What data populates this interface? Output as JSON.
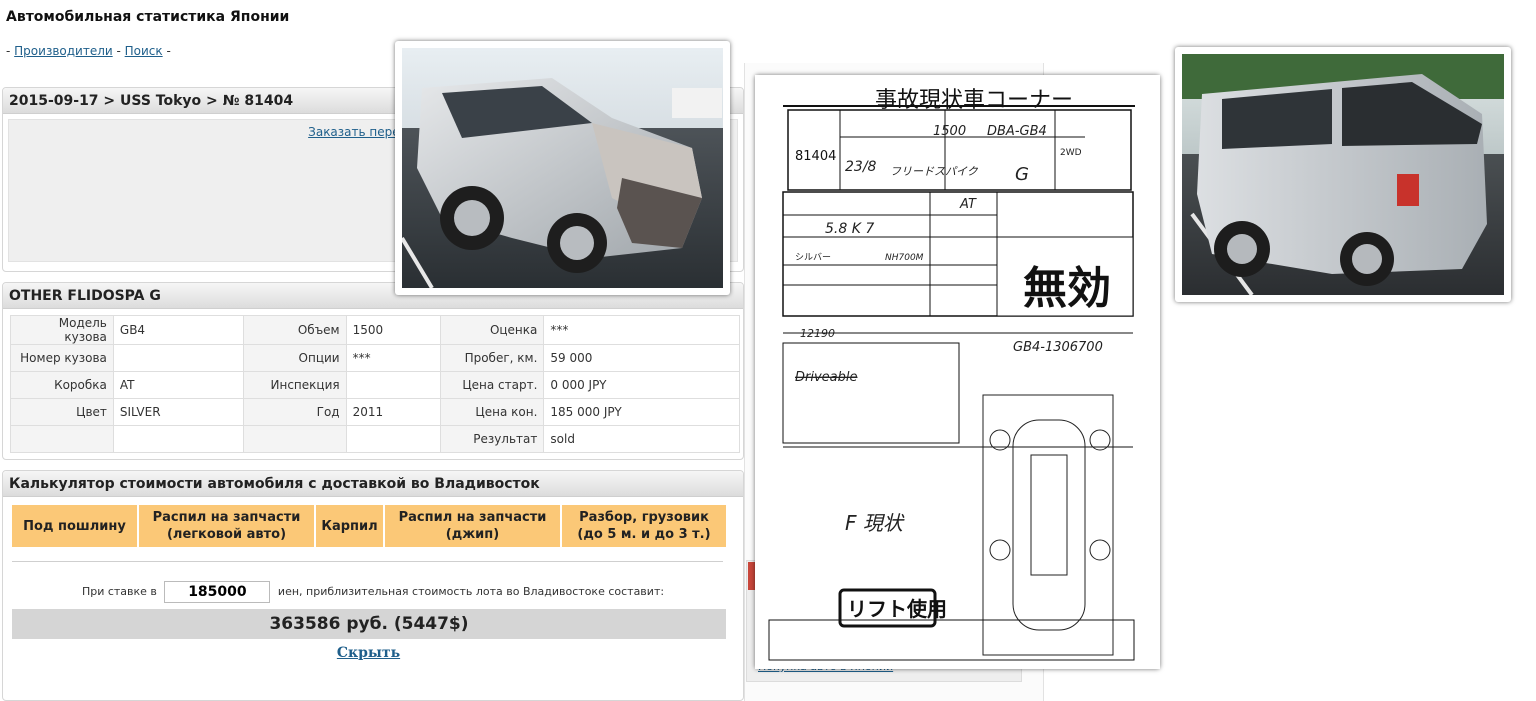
{
  "site": {
    "title": "Автомобильная статистика Японии",
    "nav": {
      "prefix": "- ",
      "link1": "Производители",
      "sep": " - ",
      "link2": "Поиск",
      "suffix": " -"
    }
  },
  "lot": {
    "header": "2015-09-17 > USS Tokyo > № 81404",
    "translate_link": "Заказать перевод аукционного"
  },
  "car": {
    "title": "OTHER FLIDOSPA G",
    "rows": [
      [
        {
          "label": "Модель кузова",
          "value": "GB4"
        },
        {
          "label": "Объем",
          "value": "1500"
        },
        {
          "label": "Оценка",
          "value": "***"
        }
      ],
      [
        {
          "label": "Номер кузова",
          "value": ""
        },
        {
          "label": "Опции",
          "value": "***"
        },
        {
          "label": "Пробег, км.",
          "value": "59 000"
        }
      ],
      [
        {
          "label": "Коробка",
          "value": "AT"
        },
        {
          "label": "Инспекция",
          "value": ""
        },
        {
          "label": "Цена старт.",
          "value": "0 000 JPY"
        }
      ],
      [
        {
          "label": "Цвет",
          "value": "SILVER"
        },
        {
          "label": "Год",
          "value": "2011"
        },
        {
          "label": "Цена кон.",
          "value": "185 000 JPY"
        }
      ],
      [
        {
          "label": "",
          "value": ""
        },
        {
          "label": "",
          "value": ""
        },
        {
          "label": "Результат",
          "value": "sold"
        }
      ]
    ]
  },
  "calc": {
    "title": "Калькулятор стоимости автомобиля с доставкой во Владивосток",
    "options": [
      "Под пошлину",
      "Распил на запчасти\n(легковой авто)",
      "Карпил",
      "Распил на запчасти\n(джип)",
      "Разбор, грузовик\n(до 5 м. и до 3 т.)"
    ],
    "rate_prefix": "При ставке в",
    "rate_value": "185000",
    "rate_suffix": "иен, приблизительная стоимость лота во Владивостоке составит:",
    "result": "363586 руб. (5447$)",
    "hide_label": "Скрыть"
  },
  "sidebar": {
    "link": "Покупка авто в Японии"
  },
  "auction_sheet": {
    "header": "事故現状車コーナー",
    "lot_no": "81404",
    "displacement": "1500",
    "model_code": "DBA-GB4",
    "year": "23/8",
    "car_name": "フリードスパイク",
    "grade": "G",
    "drive": "2WD",
    "mileage": "5.8 K 7",
    "shift": "AT",
    "color": "シルバー",
    "color_no": "NH700M",
    "invalid_stamp": "無効",
    "frame_no": "GB4-1306700",
    "recycle": "12190",
    "note": "F 現状",
    "stamp2": "リフト使用",
    "handwriting": "Driveable"
  },
  "photos": {
    "front": "front-damaged-car-photo",
    "rear": "rear-car-photo"
  }
}
